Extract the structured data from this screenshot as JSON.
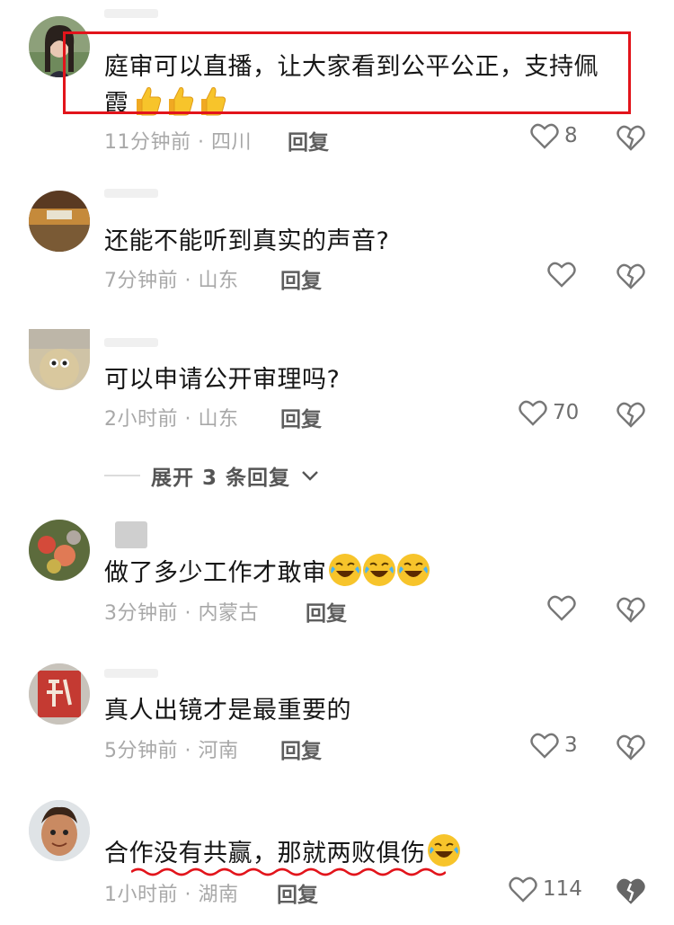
{
  "comments": [
    {
      "text_line1": "庭审可以直播，让大家看到公平公正，支持佩",
      "text_line2": "霞",
      "emoji": [
        "thumbs-up",
        "thumbs-up",
        "thumbs-up"
      ],
      "time": "11分钟前",
      "location": "四川",
      "meta": "11分钟前 · 四川",
      "reply": "回复",
      "likes": "8",
      "highlighted": true
    },
    {
      "text": "还能不能听到真实的声音?",
      "meta": "7分钟前 · 山东",
      "reply": "回复",
      "likes": ""
    },
    {
      "text": "可以申请公开审理吗?",
      "meta": "2小时前 · 山东",
      "reply": "回复",
      "likes": "70"
    },
    {
      "text": "做了多少工作才敢审",
      "emoji": [
        "laughing-tears",
        "laughing-tears",
        "laughing-tears"
      ],
      "meta": "3分钟前 · 内蒙古",
      "reply": "回复",
      "likes": ""
    },
    {
      "text": "真人出镜才是最重要的",
      "meta": "5分钟前 · 河南",
      "reply": "回复",
      "likes": "3"
    },
    {
      "text": "合作没有共赢，那就两败俱伤",
      "emoji": [
        "laughing-tears"
      ],
      "meta": "1小时前 · 湖南",
      "reply": "回复",
      "likes": "114"
    }
  ],
  "expand_replies": "展开 3 条回复",
  "colors": {
    "highlight_box": "#e2141b",
    "wavy_underline": "#e2141b",
    "emoji_yellow": "#f7c42b"
  }
}
